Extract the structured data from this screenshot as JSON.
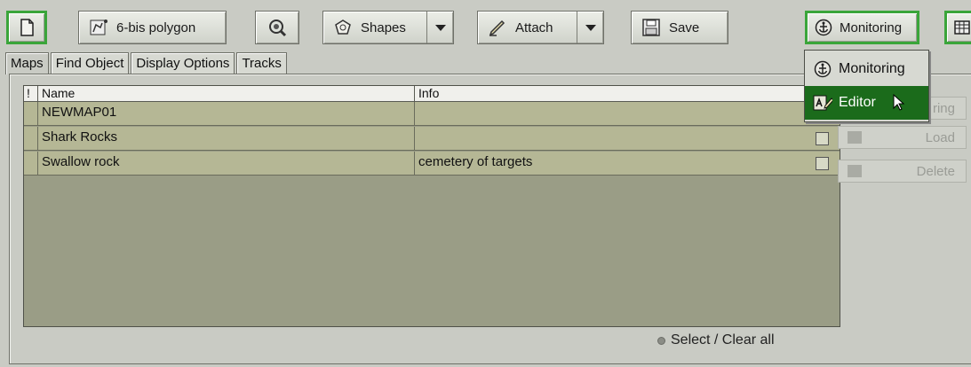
{
  "toolbar": {
    "polygon_label": "6-bis polygon",
    "shapes_label": "Shapes",
    "attach_label": "Attach",
    "save_label": "Save",
    "mode_label": "Monitoring"
  },
  "tabs": [
    {
      "label": "Maps",
      "active": true
    },
    {
      "label": "Find Object"
    },
    {
      "label": "Display Options"
    },
    {
      "label": "Tracks"
    }
  ],
  "table": {
    "columns": [
      "!",
      "Name",
      "Info"
    ],
    "rows": [
      {
        "name": "NEWMAP01",
        "info": ""
      },
      {
        "name": "Shark Rocks",
        "info": ""
      },
      {
        "name": "Swallow rock",
        "info": "cemetery of targets"
      }
    ]
  },
  "side_buttons": {
    "first_partial": "ring",
    "load": "Load",
    "delete": "Delete"
  },
  "select_all_label": "Select / Clear all",
  "mode_menu": {
    "items": [
      {
        "label": "Monitoring"
      },
      {
        "label": "Editor",
        "selected": true
      }
    ]
  },
  "colors": {
    "accent_green": "#3aa53a",
    "selected_green": "#1b6b1b",
    "grid_background": "#9a9d86",
    "row_background": "#b5b795"
  }
}
